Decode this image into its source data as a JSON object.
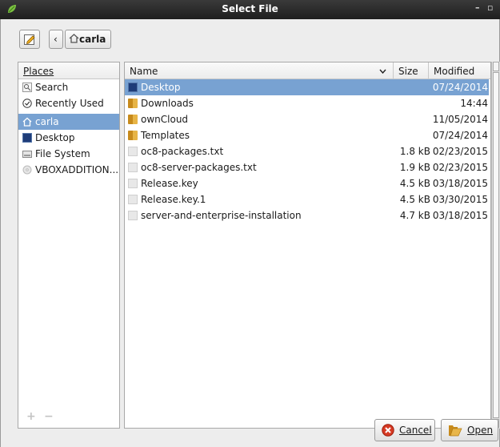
{
  "window": {
    "title": "Select File",
    "minimize": "–",
    "maximize": "▫"
  },
  "path": {
    "back": "‹",
    "crumb": "carla"
  },
  "places": {
    "header": "Places",
    "items": [
      {
        "label": "Search",
        "icon": "search-icon"
      },
      {
        "label": "Recently Used",
        "icon": "recent-icon"
      },
      {
        "label": "carla",
        "icon": "home-icon",
        "selected": true
      },
      {
        "label": "Desktop",
        "icon": "desktop-icon"
      },
      {
        "label": "File System",
        "icon": "drive-icon"
      },
      {
        "label": "VBOXADDITION...",
        "icon": "disc-icon"
      }
    ],
    "add": "+",
    "remove": "−"
  },
  "files": {
    "columns": {
      "name": "Name",
      "size": "Size",
      "modified": "Modified"
    },
    "rows": [
      {
        "name": "Desktop",
        "size": "",
        "modified": "07/24/2014",
        "type": "desktop",
        "selected": true
      },
      {
        "name": "Downloads",
        "size": "",
        "modified": "14:44",
        "type": "folder"
      },
      {
        "name": "ownCloud",
        "size": "",
        "modified": "11/05/2014",
        "type": "folder"
      },
      {
        "name": "Templates",
        "size": "",
        "modified": "07/24/2014",
        "type": "folder"
      },
      {
        "name": "oc8-packages.txt",
        "size": "1.8 kB",
        "modified": "02/23/2015",
        "type": "file"
      },
      {
        "name": "oc8-server-packages.txt",
        "size": "1.9 kB",
        "modified": "02/23/2015",
        "type": "file"
      },
      {
        "name": "Release.key",
        "size": "4.5 kB",
        "modified": "03/18/2015",
        "type": "file"
      },
      {
        "name": "Release.key.1",
        "size": "4.5 kB",
        "modified": "03/30/2015",
        "type": "file"
      },
      {
        "name": "server-and-enterprise-installation",
        "size": "4.7 kB",
        "modified": "03/18/2015",
        "type": "file"
      }
    ]
  },
  "buttons": {
    "cancel": "Cancel",
    "open": "Open"
  },
  "colors": {
    "selection": "#78a2d2",
    "titlebar": "#2a2a2a",
    "folder": "#e0a33a"
  }
}
